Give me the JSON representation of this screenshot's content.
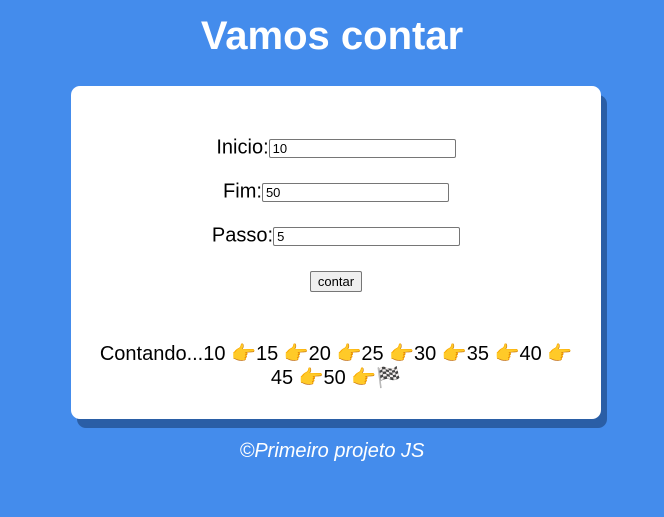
{
  "page": {
    "title": "Vamos contar",
    "footer": "©Primeiro projeto JS"
  },
  "form": {
    "inicio_label": "Inicio:",
    "inicio_value": "10",
    "fim_label": "Fim:",
    "fim_value": "50",
    "passo_label": "Passo:",
    "passo_value": "5",
    "button_label": "contar"
  },
  "result": {
    "text": "Contando...10 👉15 👉20 👉25 👉30 👉35 👉40 👉45 👉50 👉🏁"
  },
  "colors": {
    "background": "#448cec",
    "card": "#ffffff",
    "card_shadow": "#2a5ea6"
  }
}
